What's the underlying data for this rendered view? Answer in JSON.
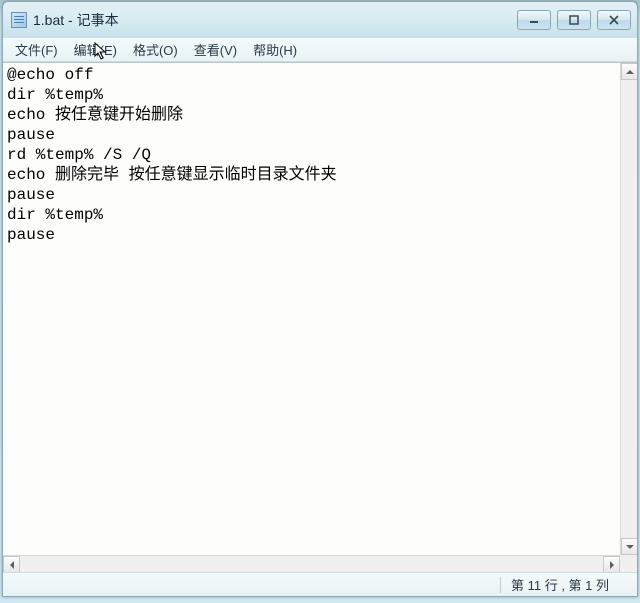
{
  "window": {
    "title": "1.bat - 记事本"
  },
  "menu": {
    "file": "文件(F)",
    "edit": "编辑(E)",
    "format": "格式(O)",
    "view": "查看(V)",
    "help": "帮助(H)"
  },
  "content": "@echo off\ndir %temp%\necho 按任意键开始删除\npause\nrd %temp% /S /Q\necho 删除完毕 按任意键显示临时目录文件夹\npause\ndir %temp%\npause",
  "status": {
    "position": "第 11 行 , 第 1 列"
  }
}
